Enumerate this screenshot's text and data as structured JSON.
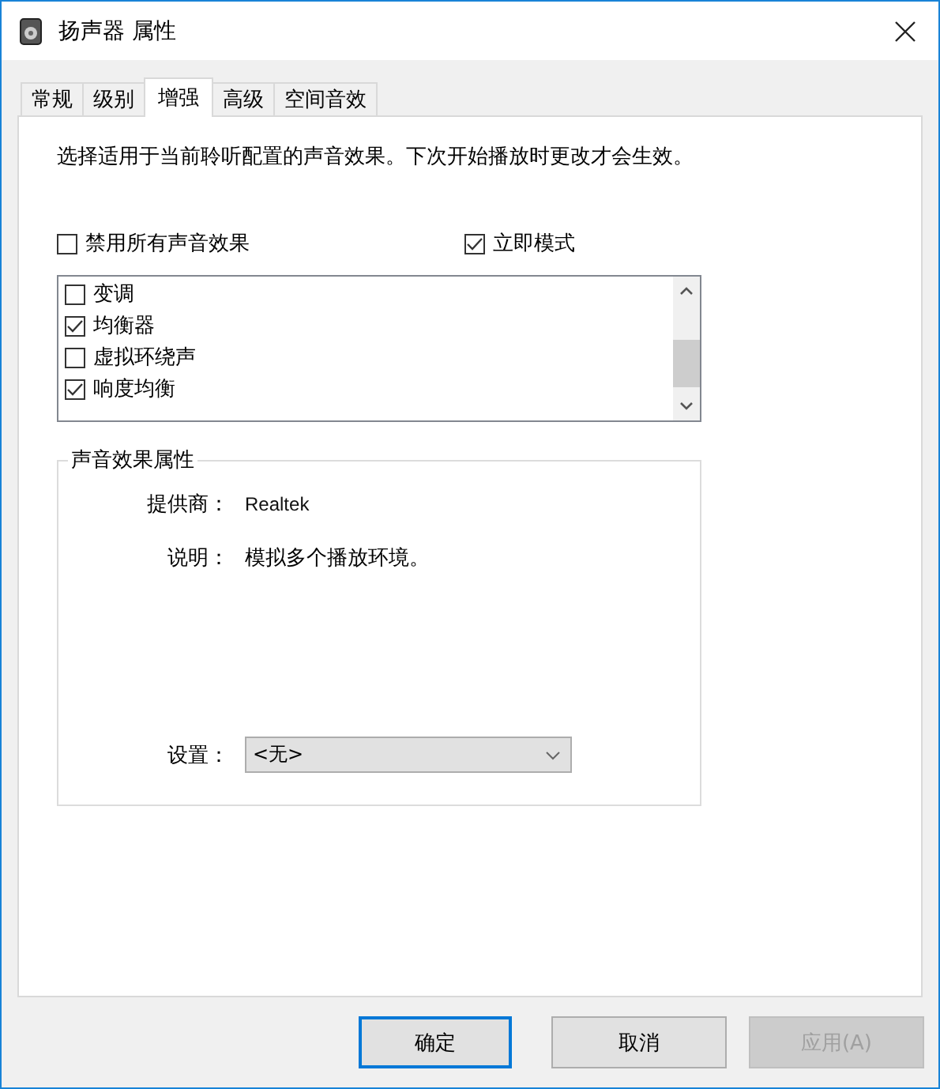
{
  "window": {
    "title": "扬声器 属性"
  },
  "tabs": [
    {
      "label": "常规",
      "selected": false
    },
    {
      "label": "级别",
      "selected": false
    },
    {
      "label": "增强",
      "selected": true
    },
    {
      "label": "高级",
      "selected": false
    },
    {
      "label": "空间音效",
      "selected": false
    }
  ],
  "description": "选择适用于当前聆听配置的声音效果。下次开始播放时更改才会生效。",
  "options": [
    {
      "label": "禁用所有声音效果",
      "checked": false
    },
    {
      "label": "立即模式",
      "checked": true
    }
  ],
  "effects": [
    {
      "label": "变调",
      "checked": false
    },
    {
      "label": "均衡器",
      "checked": true
    },
    {
      "label": "虚拟环绕声",
      "checked": false
    },
    {
      "label": "响度均衡",
      "checked": true
    }
  ],
  "properties": {
    "title": "声音效果属性",
    "provider_label": "提供商：",
    "provider": "Realtek",
    "description_label": "说明：",
    "description": "模拟多个播放环境。",
    "settings_label": "设置：",
    "settings_value": "<无>"
  },
  "buttons": [
    {
      "label": "确定",
      "default": true,
      "disabled": false
    },
    {
      "label": "取消",
      "default": false,
      "disabled": false
    },
    {
      "label": "应用(A)",
      "default": false,
      "disabled": true
    }
  ]
}
